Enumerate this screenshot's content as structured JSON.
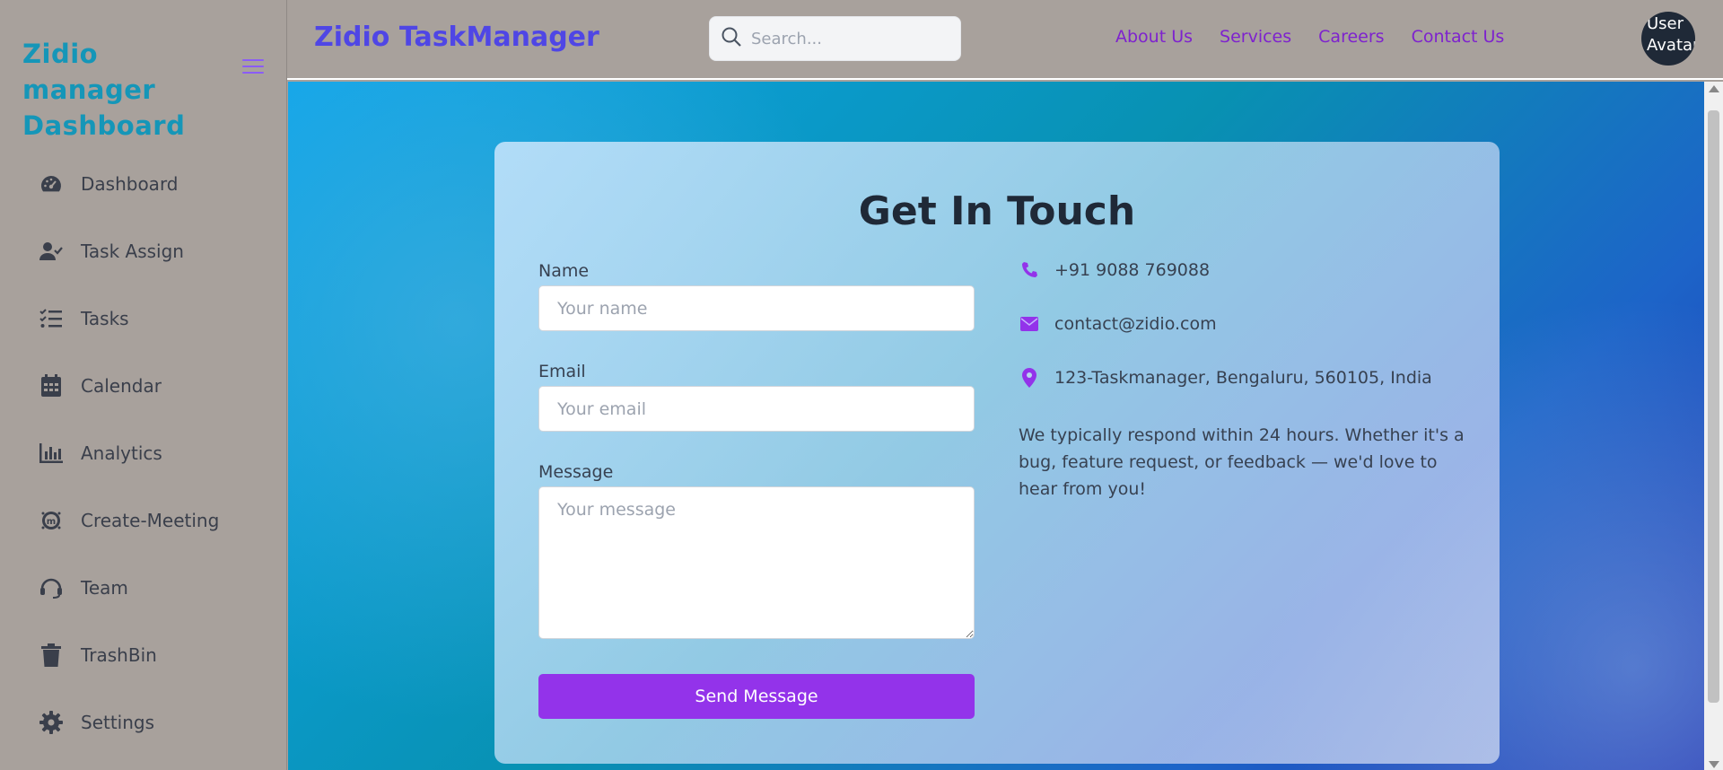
{
  "sidebar": {
    "brand": "Zidio manager Dashboard",
    "items": [
      {
        "label": "Dashboard",
        "icon": "gauge-icon"
      },
      {
        "label": "Task Assign",
        "icon": "user-check-icon"
      },
      {
        "label": "Tasks",
        "icon": "list-check-icon"
      },
      {
        "label": "Calendar",
        "icon": "calendar-icon"
      },
      {
        "label": "Analytics",
        "icon": "bar-chart-icon"
      },
      {
        "label": "Create-Meeting",
        "icon": "meeting-icon"
      },
      {
        "label": "Team",
        "icon": "headset-icon"
      },
      {
        "label": "TrashBin",
        "icon": "trash-icon"
      },
      {
        "label": "Settings",
        "icon": "gear-icon"
      }
    ]
  },
  "header": {
    "title": "Zidio TaskManager",
    "search_placeholder": "Search...",
    "links": [
      "About Us",
      "Services",
      "Careers",
      "Contact Us"
    ],
    "avatar_alt": "User Avatar"
  },
  "contact": {
    "title": "Get In Touch",
    "name_label": "Name",
    "name_placeholder": "Your name",
    "email_label": "Email",
    "email_placeholder": "Your email",
    "message_label": "Message",
    "message_placeholder": "Your message",
    "send_label": "Send Message",
    "phone": "+91 9088 769088",
    "email": "contact@zidio.com",
    "address": "123-Taskmanager, Bengaluru, 560105, India",
    "blurb": "We typically respond within 24 hours. Whether it's a bug, feature request, or feedback — we'd love to hear from you!"
  },
  "colors": {
    "accent": "#9333ea",
    "brand": "#1596b8",
    "title": "#4f46e5",
    "link": "#7e22ce"
  }
}
